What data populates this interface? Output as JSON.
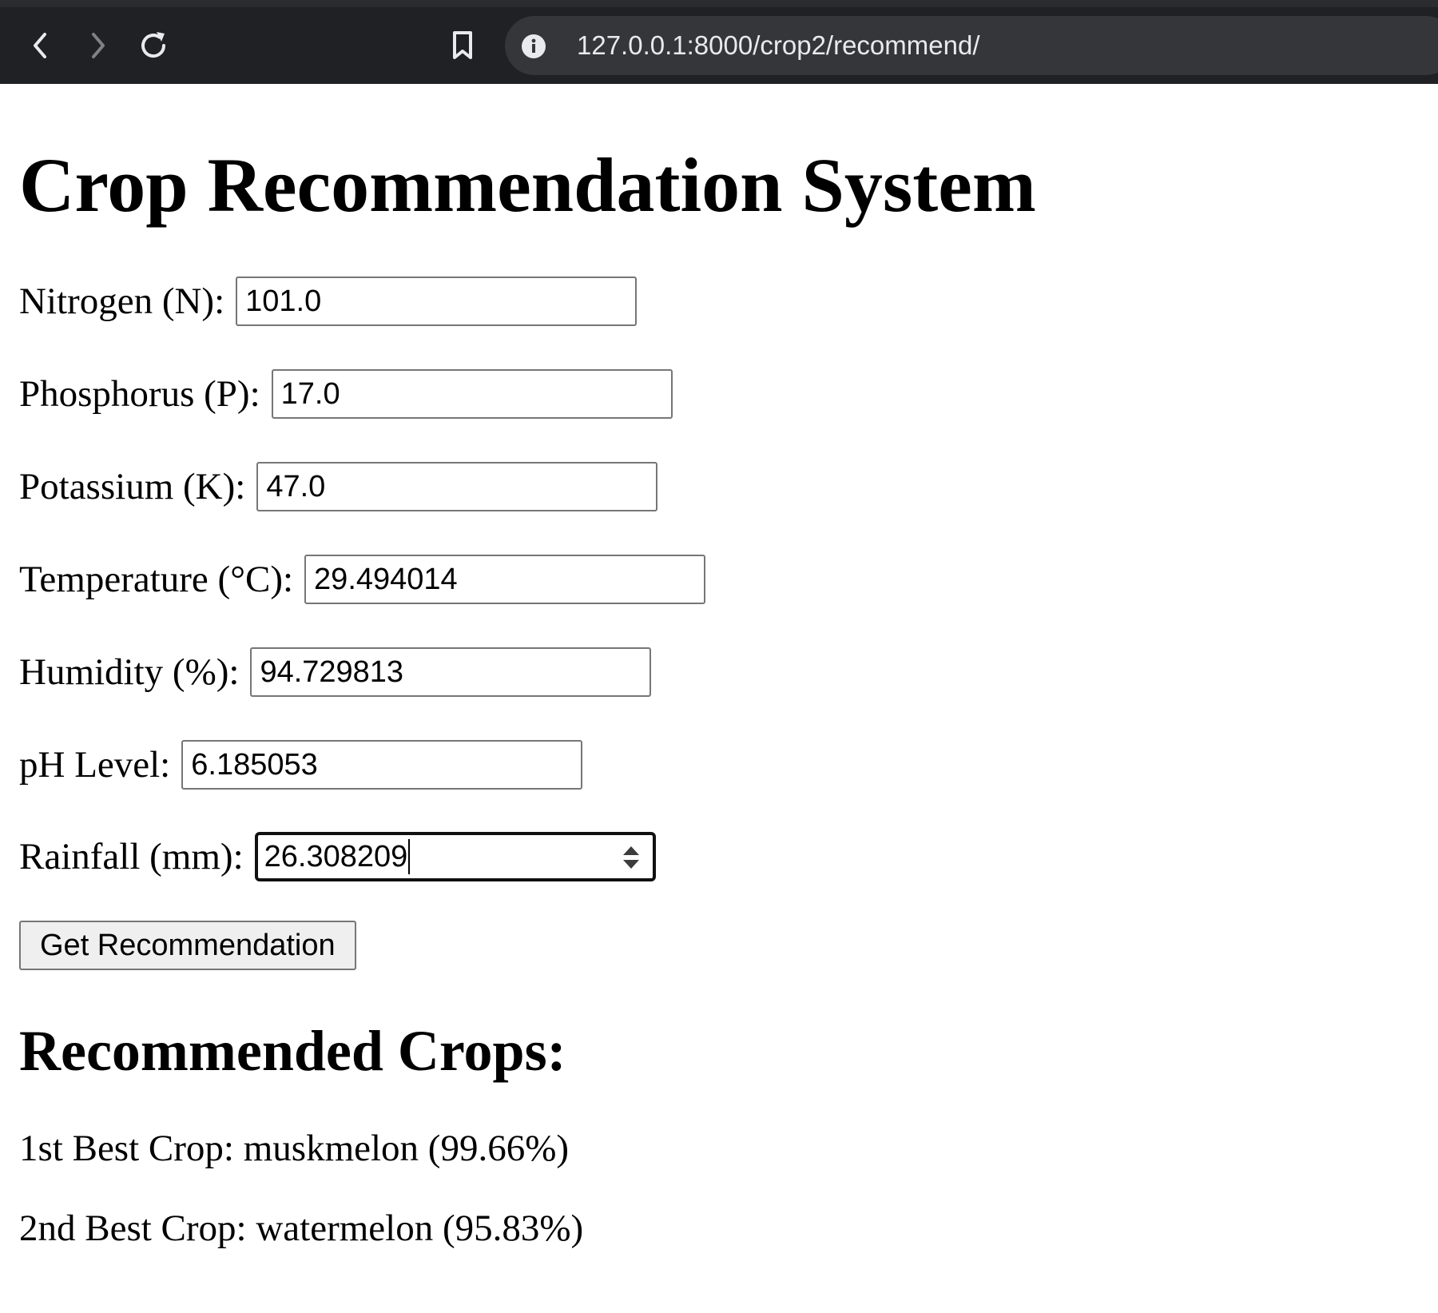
{
  "browser": {
    "url": "127.0.0.1:8000/crop2/recommend/",
    "icons": [
      "back-arrow-icon",
      "forward-arrow-icon",
      "reload-icon",
      "bookmark-icon",
      "site-info-icon"
    ]
  },
  "page": {
    "title": "Crop Recommendation System"
  },
  "form": {
    "fields": [
      {
        "label": "Nitrogen (N):",
        "value": "101.0"
      },
      {
        "label": "Phosphorus (P):",
        "value": "17.0"
      },
      {
        "label": "Potassium (K):",
        "value": "47.0"
      },
      {
        "label": "Temperature (°C):",
        "value": "29.494014"
      },
      {
        "label": "Humidity (%):",
        "value": "94.729813"
      },
      {
        "label": "pH Level:",
        "value": "6.185053"
      },
      {
        "label": "Rainfall (mm):",
        "value": "26.308209",
        "focused": true
      }
    ],
    "submit_label": "Get Recommendation"
  },
  "results": {
    "heading": "Recommended Crops:",
    "items": [
      "1st Best Crop: muskmelon (99.66%)",
      "2nd Best Crop: watermelon (95.83%)"
    ]
  }
}
